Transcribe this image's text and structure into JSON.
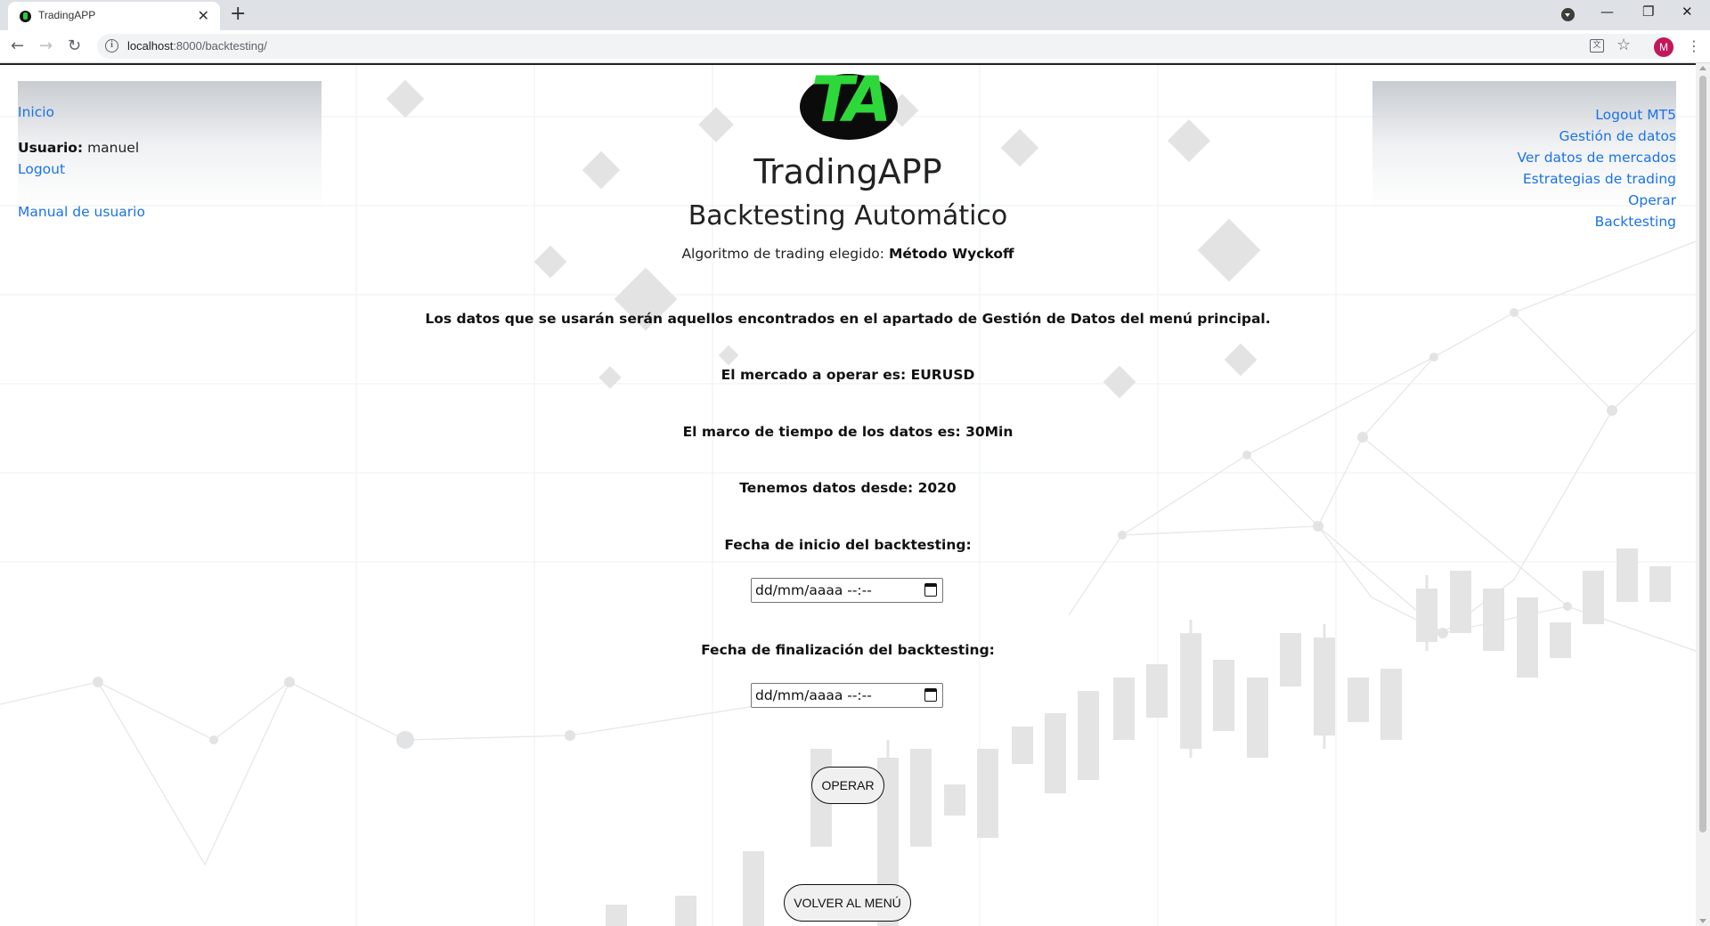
{
  "browser": {
    "tab_title": "TradingAPP",
    "tab_close": "✕",
    "new_tab": "+",
    "url_host": "localhost",
    "url_path": ":8000/backtesting/",
    "avatar_letter": "M",
    "window_minimize": "—",
    "window_restore": "❐",
    "window_close": "✕"
  },
  "left_nav": {
    "home": "Inicio",
    "user_label": "Usuario:",
    "user_name": "manuel",
    "logout": "Logout",
    "manual": "Manual de usuario"
  },
  "right_nav": {
    "items": [
      "Logout MT5",
      "Gestión de datos",
      "Ver datos de mercados",
      "Estrategias de trading",
      "Operar",
      "Backtesting"
    ]
  },
  "logo": {
    "text": "TA"
  },
  "header": {
    "app_title": "TradingAPP",
    "page_title": "Backtesting Automático",
    "algo_prefix": "Algoritmo de trading elegido:",
    "algo_name": "Método Wyckoff"
  },
  "info": {
    "data_source": "Los datos que se usarán serán aquellos encontrados en el apartado de Gestión de Datos del menú principal.",
    "market": "El mercado a operar es: EURUSD",
    "timeframe": "El marco de tiempo de los datos es: 30Min",
    "data_since": "Tenemos datos desde: 2020"
  },
  "form": {
    "start_label": "Fecha de inicio del backtesting:",
    "start_placeholder": "dd/mm/aaaa --:--",
    "end_label": "Fecha de finalización del backtesting:",
    "end_placeholder": "dd/mm/aaaa --:--",
    "operate_button": "OPERAR",
    "back_button": "VOLVER AL MENÚ"
  },
  "colors": {
    "link": "#1a73e8",
    "logo_green": "#2ed83a",
    "avatar": "#c2185b"
  }
}
